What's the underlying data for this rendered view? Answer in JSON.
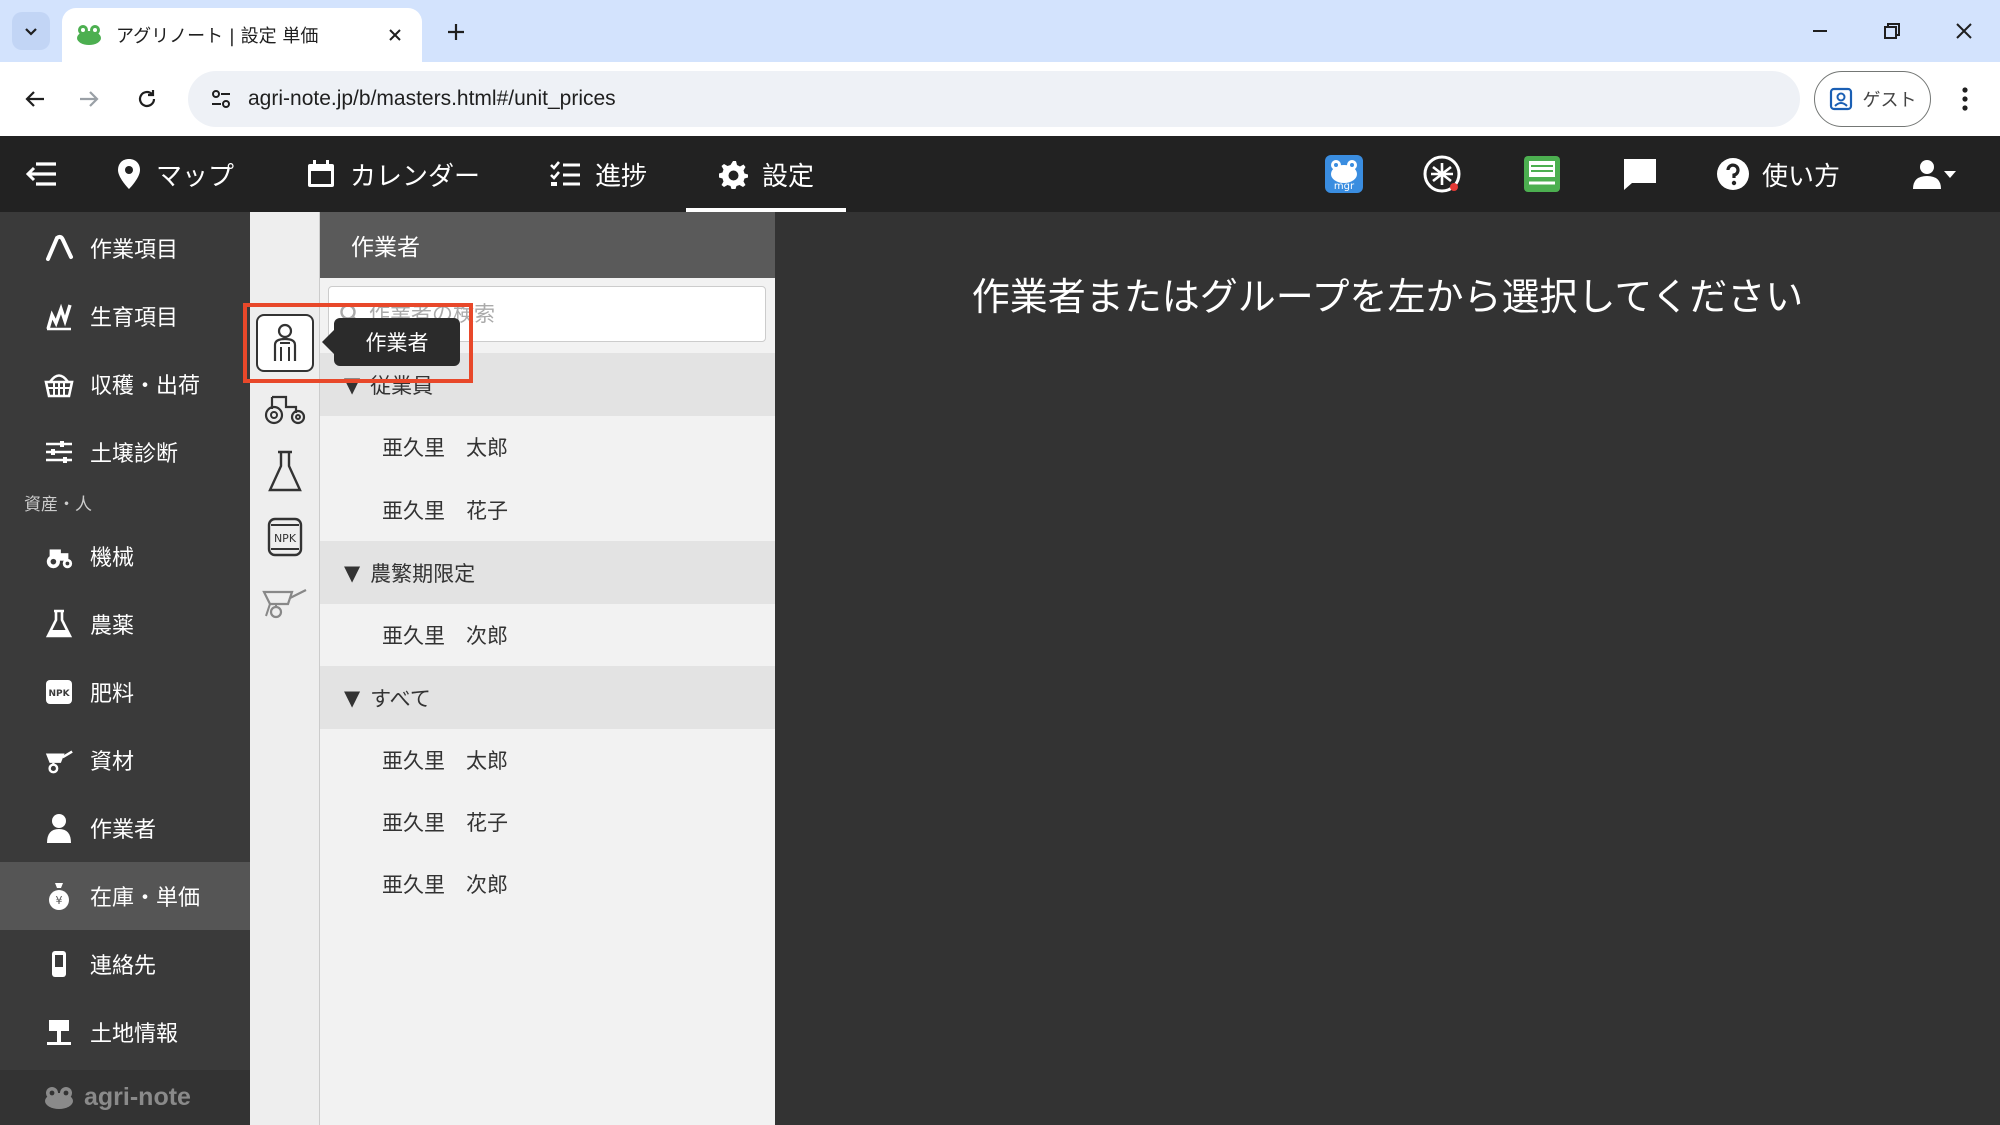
{
  "browser": {
    "tab_title": "アグリノート | 設定 単価",
    "url": "agri-note.jp/b/masters.html#/unit_prices",
    "guest_label": "ゲスト"
  },
  "header": {
    "nav": [
      {
        "label": "マップ",
        "icon": "map-pin-icon"
      },
      {
        "label": "カレンダー",
        "icon": "calendar-icon"
      },
      {
        "label": "進捗",
        "icon": "checklist-icon"
      },
      {
        "label": "設定",
        "icon": "gear-icon",
        "active": true
      }
    ],
    "help_label": "使い方",
    "mgr_badge": "mgr"
  },
  "sidebar": {
    "items": [
      {
        "label": "作業項目",
        "icon": "work-item-icon"
      },
      {
        "label": "生育項目",
        "icon": "growth-icon"
      },
      {
        "label": "収穫・出荷",
        "icon": "basket-icon"
      },
      {
        "label": "土壌診断",
        "icon": "sliders-icon"
      },
      {
        "label": "機械",
        "icon": "tractor-icon"
      },
      {
        "label": "農薬",
        "icon": "flask-icon"
      },
      {
        "label": "肥料",
        "icon": "npk-icon"
      },
      {
        "label": "資材",
        "icon": "wheelbarrow-icon"
      },
      {
        "label": "作業者",
        "icon": "person-icon"
      },
      {
        "label": "在庫・単価",
        "icon": "money-bag-icon",
        "active": true
      },
      {
        "label": "連絡先",
        "icon": "phone-icon"
      },
      {
        "label": "土地情報",
        "icon": "signpost-icon"
      }
    ],
    "section_label": "資産・人",
    "logo_text": "agri-note"
  },
  "icon_strip": {
    "npk_label": "NPK"
  },
  "list_panel": {
    "title": "作業者",
    "search_placeholder": "作業者の検索",
    "groups": [
      {
        "name": "従業員",
        "members": [
          "亜久里　太郎",
          "亜久里　花子"
        ]
      },
      {
        "name": "農繁期限定",
        "members": [
          "亜久里　次郎"
        ]
      },
      {
        "name": "すべて",
        "members": [
          "亜久里　太郎",
          "亜久里　花子",
          "亜久里　次郎"
        ]
      }
    ],
    "tooltip": "作業者"
  },
  "main": {
    "message": "作業者またはグループを左から選択してください"
  }
}
